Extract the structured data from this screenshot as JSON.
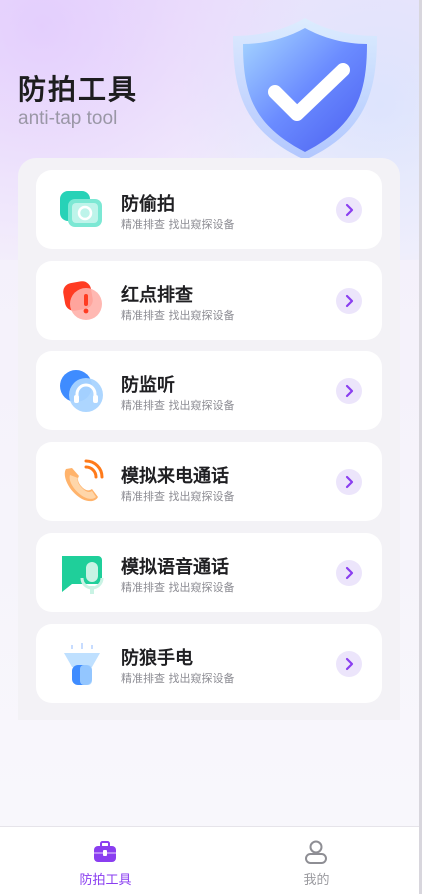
{
  "header": {
    "title": "防拍工具",
    "subtitle": "anti-tap tool"
  },
  "tools": [
    {
      "name": "防偷拍",
      "desc": "精准排查 找出窥探设备",
      "icon": "camera-icon"
    },
    {
      "name": "红点排查",
      "desc": "精准排查 找出窥探设备",
      "icon": "red-dot-alert-icon"
    },
    {
      "name": "防监听",
      "desc": "精准排查 找出窥探设备",
      "icon": "headset-icon"
    },
    {
      "name": "模拟来电通话",
      "desc": "精准排查 找出窥探设备",
      "icon": "phone-call-icon"
    },
    {
      "name": "模拟语音通话",
      "desc": "精准排查 找出窥探设备",
      "icon": "voice-chat-icon"
    },
    {
      "name": "防狼手电",
      "desc": "精准排查 找出窥探设备",
      "icon": "flashlight-icon"
    }
  ],
  "tabbar": {
    "items": [
      {
        "label": "防拍工具",
        "icon": "toolbox-icon",
        "active": true
      },
      {
        "label": "我的",
        "icon": "person-icon",
        "active": false
      }
    ]
  },
  "colors": {
    "accent": "#8a3ef0",
    "inactive": "#9a9a9f",
    "arrow_bg": "#ece5fb"
  }
}
